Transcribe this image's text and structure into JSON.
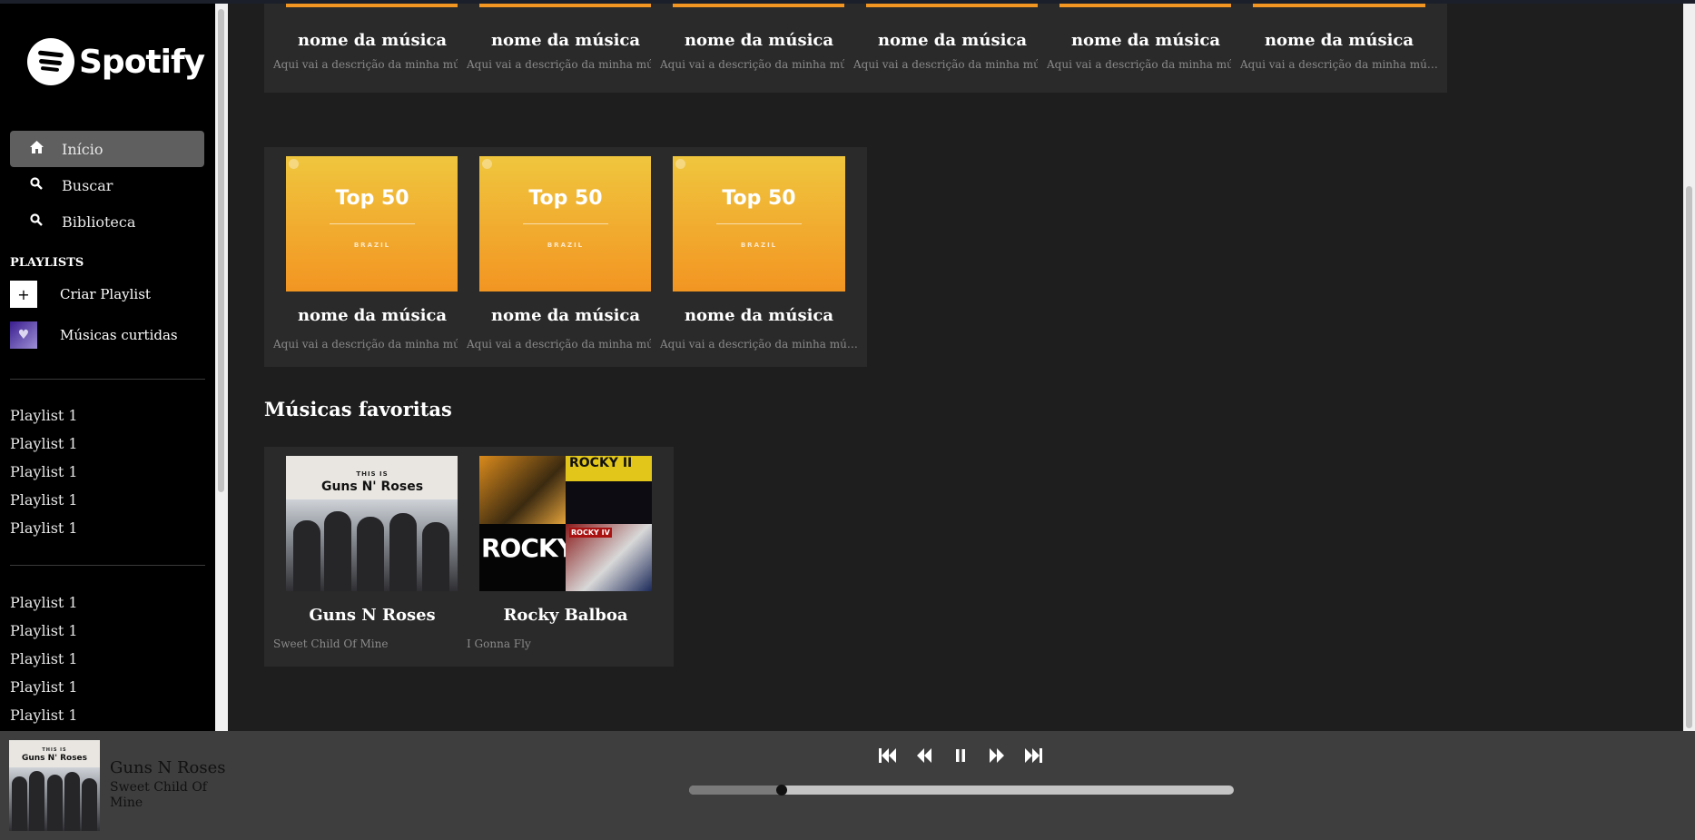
{
  "app": {
    "logo_text": "Spotify"
  },
  "sidebar": {
    "nav": [
      {
        "label": "Início",
        "icon": "home-icon",
        "active": true
      },
      {
        "label": "Buscar",
        "icon": "search-icon",
        "active": false
      },
      {
        "label": "Biblioteca",
        "icon": "search-icon",
        "active": false
      }
    ],
    "playlists_title": "PLAYLISTS",
    "create_playlist": "Criar Playlist",
    "liked_songs": "Músicas curtidas",
    "playlist_group_1": [
      "Playlist 1",
      "Playlist 1",
      "Playlist 1",
      "Playlist 1",
      "Playlist 1"
    ],
    "playlist_group_2": [
      "Playlist 1",
      "Playlist 1",
      "Playlist 1",
      "Playlist 1",
      "Playlist 1"
    ]
  },
  "main": {
    "row1": [
      {
        "title": "nome da música",
        "desc": "Aqui vai a descrição da minha música..."
      },
      {
        "title": "nome da música",
        "desc": "Aqui vai a descrição da minha música..."
      },
      {
        "title": "nome da música",
        "desc": "Aqui vai a descrição da minha música..."
      },
      {
        "title": "nome da música",
        "desc": "Aqui vai a descrição da minha música..."
      },
      {
        "title": "nome da música",
        "desc": "Aqui vai a descrição da minha música..."
      },
      {
        "title": "nome da música",
        "desc": "Aqui vai a descrição da minha música..."
      }
    ],
    "row2": [
      {
        "title": "nome da música",
        "desc": "Aqui vai a descrição da minha música...",
        "cover_title": "Top 50",
        "cover_sub": "BRAZIL"
      },
      {
        "title": "nome da música",
        "desc": "Aqui vai a descrição da minha música...",
        "cover_title": "Top 50",
        "cover_sub": "BRAZIL"
      },
      {
        "title": "nome da música",
        "desc": "Aqui vai a descrição da minha música...",
        "cover_title": "Top 50",
        "cover_sub": "BRAZIL"
      }
    ],
    "favorites_title": "Músicas favoritas",
    "favorites": [
      {
        "title": "Guns N Roses",
        "desc": "Sweet Child Of Mine",
        "cover_small": "THIS IS",
        "cover_big": "Guns N' Roses"
      },
      {
        "title": "Rocky Balboa",
        "desc": "I Gonna Fly",
        "cover_top": "ROCKY II",
        "cover_bottom": "ROCKY",
        "cover_badge": "ROCKY IV"
      }
    ]
  },
  "player": {
    "title": "Guns N Roses",
    "artist": "Sweet Child Of Mine",
    "cover_small": "THIS IS",
    "cover_big": "Guns N' Roses",
    "progress": 0.17,
    "controls": [
      "skip-back-icon",
      "rewind-icon",
      "pause-icon",
      "fast-forward-icon",
      "skip-forward-icon"
    ]
  },
  "colors": {
    "accent": "#f29522",
    "background": "#1e1e1e",
    "sidebar": "#000000",
    "player": "#3e3e3e"
  }
}
